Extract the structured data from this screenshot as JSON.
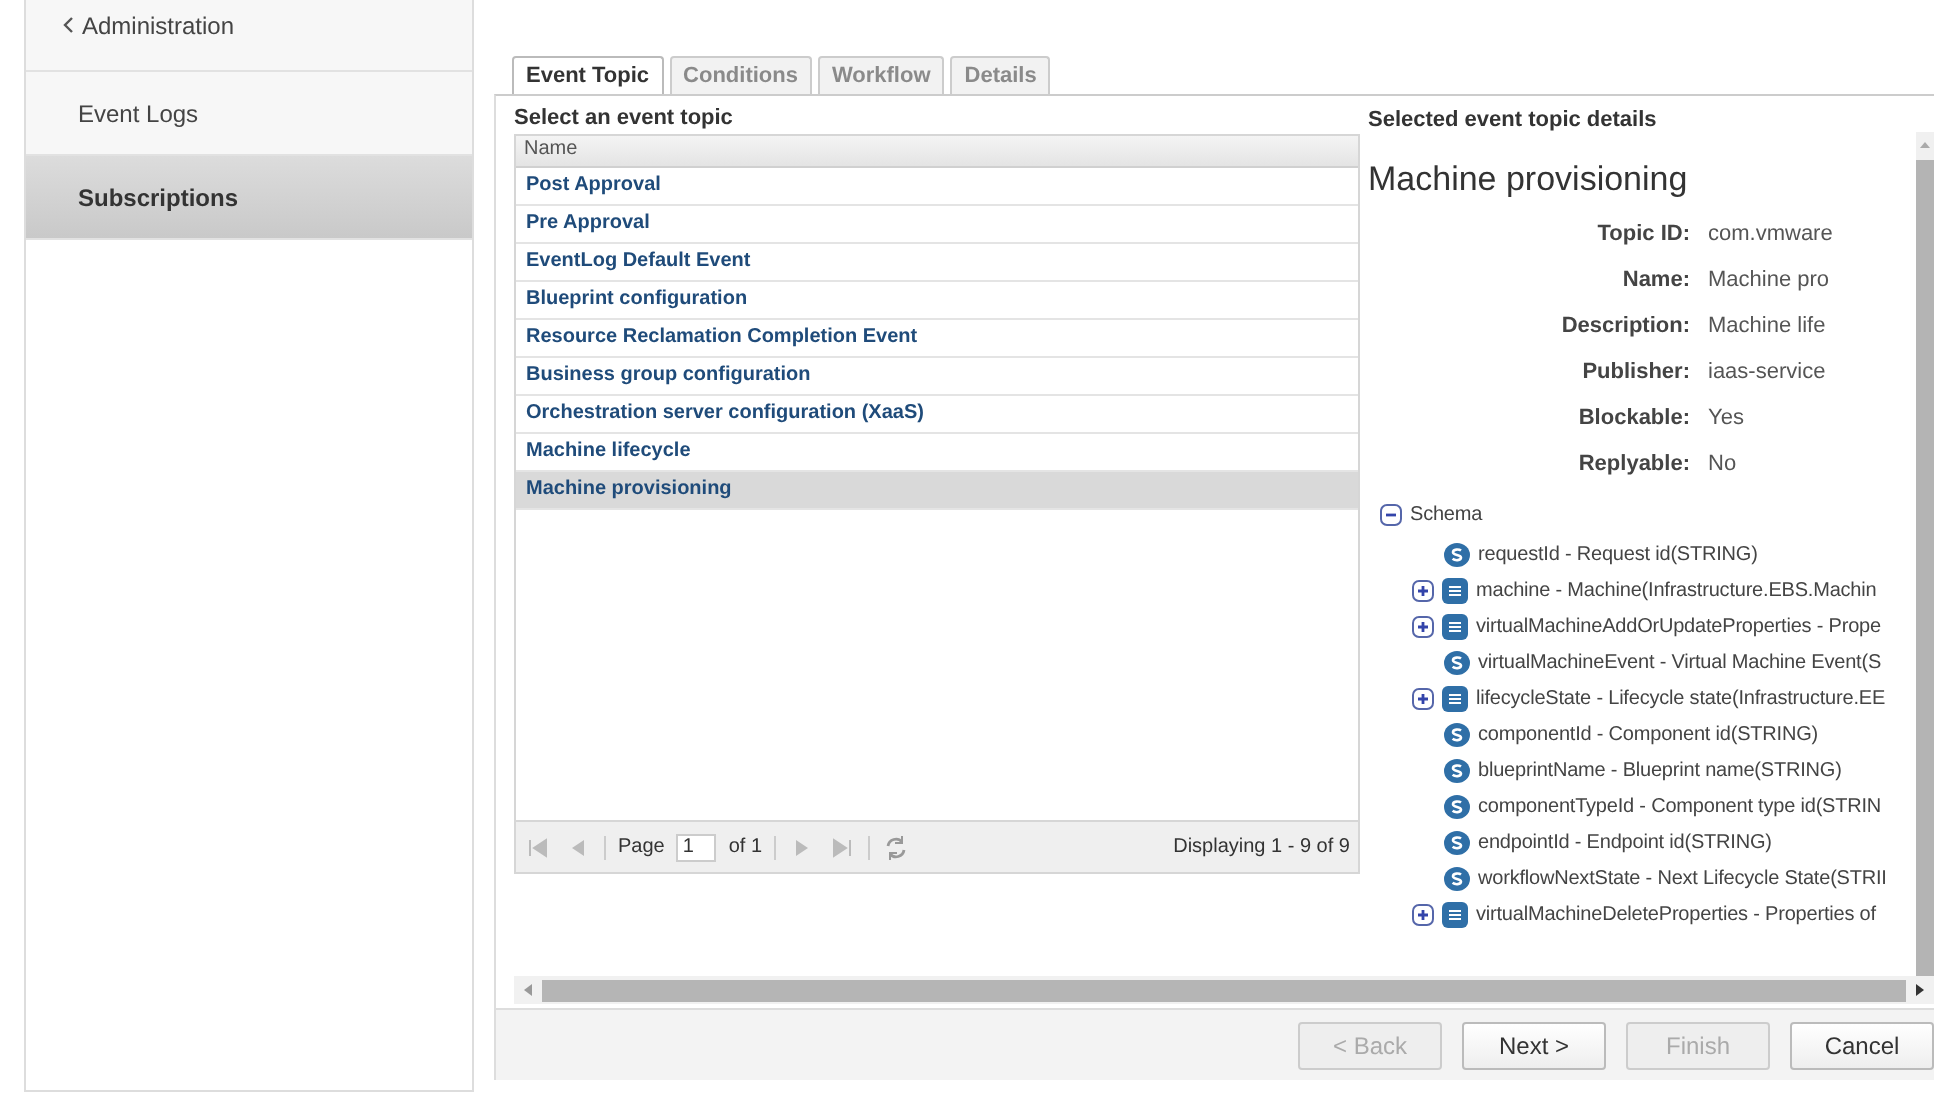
{
  "sidebar": {
    "items": [
      {
        "label": "Administration",
        "kind": "back",
        "selected": false
      },
      {
        "label": "Event Logs",
        "kind": "item",
        "selected": false
      },
      {
        "label": "Subscriptions",
        "kind": "item",
        "selected": true
      }
    ]
  },
  "tabs": [
    {
      "label": "Event Topic",
      "selected": true,
      "disabled": false
    },
    {
      "label": "Conditions",
      "selected": false,
      "disabled": true
    },
    {
      "label": "Workflow",
      "selected": false,
      "disabled": true
    },
    {
      "label": "Details",
      "selected": false,
      "disabled": true
    }
  ],
  "topic_list": {
    "title": "Select an event topic",
    "columns": [
      "Name"
    ],
    "rows": [
      {
        "name": "Post Approval",
        "selected": false
      },
      {
        "name": "Pre Approval",
        "selected": false
      },
      {
        "name": "EventLog Default Event",
        "selected": false
      },
      {
        "name": "Blueprint configuration",
        "selected": false
      },
      {
        "name": "Resource Reclamation Completion Event",
        "selected": false
      },
      {
        "name": "Business group configuration",
        "selected": false
      },
      {
        "name": "Orchestration server configuration (XaaS)",
        "selected": false
      },
      {
        "name": "Machine lifecycle",
        "selected": false
      },
      {
        "name": "Machine provisioning",
        "selected": true
      }
    ],
    "pager": {
      "page_label": "Page",
      "page": "1",
      "of": "of 1",
      "display": "Displaying 1 - 9 of 9"
    }
  },
  "details": {
    "title": "Selected event topic details",
    "heading": "Machine provisioning",
    "fields": [
      {
        "label": "Topic ID:",
        "value": "com.vmware"
      },
      {
        "label": "Name:",
        "value": "Machine pro"
      },
      {
        "label": "Description:",
        "value": "Machine life"
      },
      {
        "label": "Publisher:",
        "value": "iaas-service"
      },
      {
        "label": "Blockable:",
        "value": "Yes"
      },
      {
        "label": "Replyable:",
        "value": "No"
      }
    ],
    "schema": {
      "label": "Schema",
      "expanded": true,
      "children": [
        {
          "kind": "string",
          "label": "requestId - Request id(STRING)"
        },
        {
          "kind": "object",
          "expanded": false,
          "label": "machine - Machine(Infrastructure.EBS.Machin"
        },
        {
          "kind": "object",
          "expanded": false,
          "label": "virtualMachineAddOrUpdateProperties - Prope"
        },
        {
          "kind": "string",
          "label": "virtualMachineEvent - Virtual Machine Event(S"
        },
        {
          "kind": "object",
          "expanded": false,
          "label": "lifecycleState - Lifecycle state(Infrastructure.EE"
        },
        {
          "kind": "string",
          "label": "componentId - Component id(STRING)"
        },
        {
          "kind": "string",
          "label": "blueprintName - Blueprint name(STRING)"
        },
        {
          "kind": "string",
          "label": "componentTypeId - Component type id(STRIN"
        },
        {
          "kind": "string",
          "label": "endpointId - Endpoint id(STRING)"
        },
        {
          "kind": "string",
          "label": "workflowNextState - Next Lifecycle State(STRII"
        },
        {
          "kind": "object",
          "expanded": false,
          "label": "virtualMachineDeleteProperties - Properties of"
        }
      ]
    }
  },
  "buttons": [
    {
      "label": "< Back",
      "disabled": true
    },
    {
      "label": "Next >",
      "disabled": false
    },
    {
      "label": "Finish",
      "disabled": true
    },
    {
      "label": "Cancel",
      "disabled": false
    }
  ]
}
